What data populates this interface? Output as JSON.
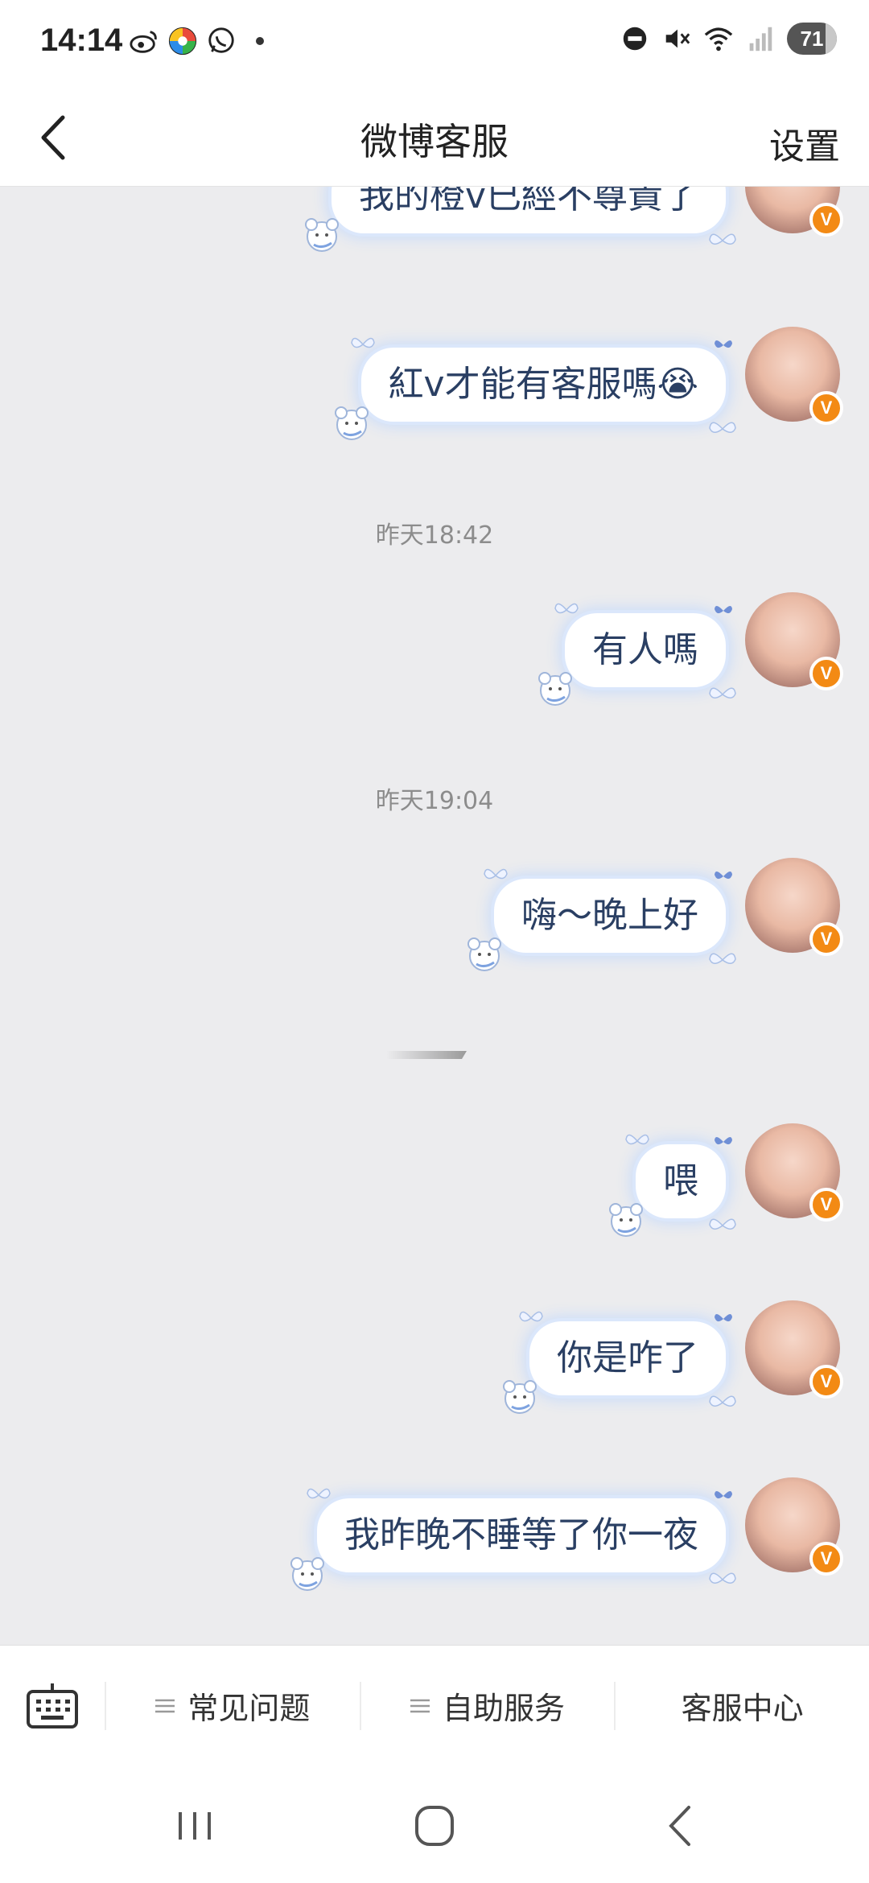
{
  "status_bar": {
    "time": "14:14",
    "battery": "71",
    "icons": [
      "weibo-icon",
      "colorful-app-icon",
      "whatsapp-icon",
      "dot-icon",
      "dnd-icon",
      "mute-icon",
      "wifi-icon",
      "signal-icon"
    ]
  },
  "header": {
    "title": "微博客服",
    "settings_label": "设置"
  },
  "messages": [
    {
      "text": "我的橙v已經不尊貴了"
    },
    {
      "text": "紅v才能有客服嗎😭"
    },
    {
      "timestamp": "昨天18:42"
    },
    {
      "text": "有人嗎"
    },
    {
      "timestamp": "昨天19:04"
    },
    {
      "text": "嗨～晚上好"
    },
    {
      "text": "喂"
    },
    {
      "text": "你是咋了"
    },
    {
      "text": "我昨晚不睡等了你一夜"
    }
  ],
  "avatar_badge": "V",
  "toolbar": {
    "items": [
      {
        "label": "常见问题"
      },
      {
        "label": "自助服务"
      },
      {
        "label": "客服中心"
      }
    ]
  },
  "colors": {
    "accent_badge": "#f38a14",
    "bubble_glow": "#c9dcfa",
    "bubble_text": "#2a3f63",
    "background": "#ececee"
  }
}
